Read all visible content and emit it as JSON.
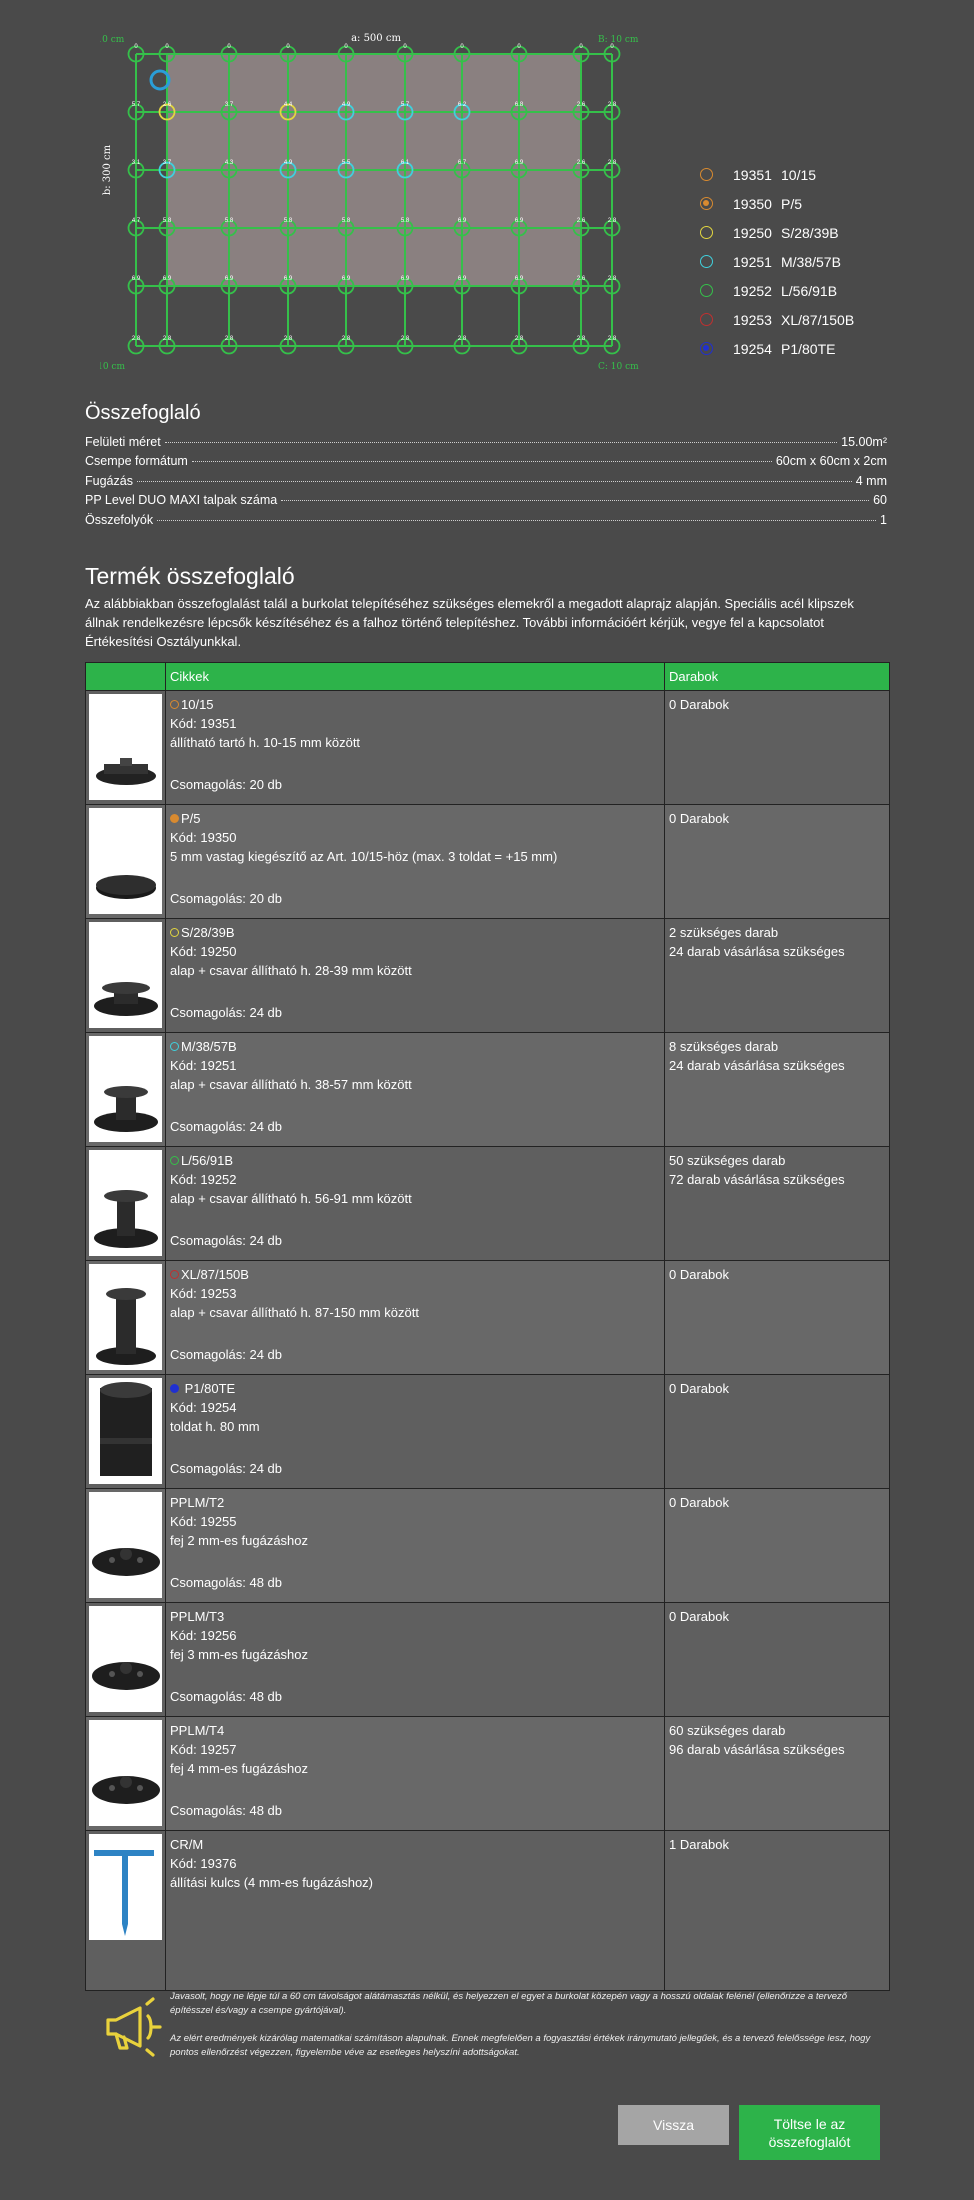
{
  "plan": {
    "width_label": "a: 500 cm",
    "height_label": "b: 300 cm",
    "corner_a": "A: 10 cm",
    "corner_b": "B: 10 cm",
    "corner_c": "C: 10 cm",
    "corner_d": "D: 10 cm",
    "row_labels": [
      [
        "0",
        "0",
        "0",
        "0",
        "0",
        "0",
        "0",
        "0",
        "0",
        "0"
      ],
      [
        "5.7",
        "2.6",
        "3.7",
        "4.4",
        "4.9",
        "5.7",
        "6.2",
        "6.8",
        "2.6",
        "2.8"
      ],
      [
        "3.1",
        "3.7",
        "4.3",
        "4.9",
        "5.5",
        "6.1",
        "6.7",
        "6.9",
        "2.6",
        "2.8"
      ],
      [
        "4.7",
        "5.8",
        "5.8",
        "5.8",
        "5.8",
        "5.8",
        "6.9",
        "6.9",
        "2.6",
        "2.8"
      ],
      [
        "6.9",
        "6.9",
        "6.9",
        "6.9",
        "6.9",
        "6.9",
        "6.9",
        "6.9",
        "2.6",
        "2.8"
      ],
      [
        "2.8",
        "2.8",
        "2.8",
        "2.8",
        "2.8",
        "2.8",
        "2.8",
        "2.8",
        "2.8",
        "2.8"
      ]
    ],
    "row_colors": [
      [
        "green",
        "green",
        "green",
        "green",
        "green",
        "green",
        "green",
        "green",
        "green",
        "green"
      ],
      [
        "green",
        "yellow",
        "green",
        "yellow",
        "cyan",
        "cyan",
        "cyan",
        "green",
        "green",
        "green"
      ],
      [
        "green",
        "cyan",
        "green",
        "cyan",
        "cyan",
        "cyan",
        "green",
        "green",
        "green",
        "green"
      ],
      [
        "green",
        "green",
        "green",
        "green",
        "green",
        "green",
        "green",
        "green",
        "green",
        "green"
      ],
      [
        "green",
        "green",
        "green",
        "green",
        "green",
        "green",
        "green",
        "green",
        "green",
        "green"
      ],
      [
        "green",
        "green",
        "green",
        "green",
        "green",
        "green",
        "green",
        "green",
        "green",
        "green"
      ]
    ],
    "colors": {
      "green": "#35c04a",
      "yellow": "#e2d640",
      "cyan": "#40d0dc",
      "blue": "#2a9ed8",
      "tile": "#8a8080"
    }
  },
  "legend": [
    {
      "code": "19351",
      "name": "10/15",
      "color": "#d88a30",
      "fill": ""
    },
    {
      "code": "19350",
      "name": "P/5",
      "color": "#d88a30",
      "fill": "#d88a30"
    },
    {
      "code": "19250",
      "name": "S/28/39B",
      "color": "#e2d640",
      "fill": ""
    },
    {
      "code": "19251",
      "name": "M/38/57B",
      "color": "#40d0dc",
      "fill": ""
    },
    {
      "code": "19252",
      "name": "L/56/91B",
      "color": "#35c04a",
      "fill": ""
    },
    {
      "code": "19253",
      "name": "XL/87/150B",
      "color": "#c03030",
      "fill": ""
    },
    {
      "code": "19254",
      "name": "P1/80TE",
      "color": "#2030d0",
      "fill": "#2030d0"
    }
  ],
  "summary": {
    "title": "Összefoglaló",
    "rows": [
      {
        "label": "Felületi méret",
        "value": "15.00m²"
      },
      {
        "label": "Csempe formátum",
        "value": "60cm x 60cm x 2cm"
      },
      {
        "label": "Fugázás",
        "value": "4 mm"
      },
      {
        "label": "PP Level DUO MAXI talpak száma",
        "value": "60"
      },
      {
        "label": "Összefolyók",
        "value": "1"
      }
    ]
  },
  "products": {
    "title": "Termék összefoglaló",
    "description": "Az alábbiakban összefoglalást talál a burkolat telepítéséhez szükséges elemekről a megadott alaprajz alapján. Speciális acél klipszek állnak rendelkezésre lépcsők készítéséhez és a falhoz történő telepítéshez. További információért kérjük, vegye fel a kapcsolatot Értékesítési Osztályunkkal.",
    "col_items": "Cikkek",
    "col_pieces": "Darabok",
    "items": [
      {
        "name": "10/15",
        "code": "Kód: 19351",
        "desc": "állítható tartó h. 10-15 mm között",
        "pack": "Csomagolás: 20 db",
        "qty1": "0 Darabok",
        "qty2": "",
        "dot": "#d88a30",
        "dotfill": ""
      },
      {
        "name": "P/5",
        "code": "Kód: 19350",
        "desc": "5 mm vastag kiegészítő az Art. 10/15-höz (max. 3 toldat = +15 mm)",
        "pack": "Csomagolás: 20 db",
        "qty1": "0 Darabok",
        "qty2": "",
        "dot": "#d88a30",
        "dotfill": "#d88a30"
      },
      {
        "name": "S/28/39B",
        "code": "Kód: 19250",
        "desc": "alap + csavar állítható h. 28-39 mm között",
        "pack": "Csomagolás: 24 db",
        "qty1": "2 szükséges darab",
        "qty2": "24 darab vásárlása szükséges",
        "dot": "#e2d640",
        "dotfill": ""
      },
      {
        "name": "M/38/57B",
        "code": "Kód: 19251",
        "desc": "alap + csavar állítható h. 38-57 mm között",
        "pack": "Csomagolás: 24 db",
        "qty1": "8 szükséges darab",
        "qty2": "24 darab vásárlása szükséges",
        "dot": "#40d0dc",
        "dotfill": ""
      },
      {
        "name": "L/56/91B",
        "code": "Kód: 19252",
        "desc": "alap + csavar állítható h. 56-91 mm között",
        "pack": "Csomagolás: 24 db",
        "qty1": "50 szükséges darab",
        "qty2": "72 darab vásárlása szükséges",
        "dot": "#35c04a",
        "dotfill": ""
      },
      {
        "name": "XL/87/150B",
        "code": "Kód: 19253",
        "desc": "alap + csavar állítható h. 87-150 mm között",
        "pack": "Csomagolás: 24 db",
        "qty1": "0 Darabok",
        "qty2": "",
        "dot": "#c03030",
        "dotfill": ""
      },
      {
        "name": " P1/80TE",
        "code": "Kód: 19254",
        "desc": "toldat h. 80 mm",
        "pack": "Csomagolás: 24 db",
        "qty1": "0 Darabok",
        "qty2": "",
        "dot": "#2030d0",
        "dotfill": "#2030d0"
      },
      {
        "name": "PPLM/T2",
        "code": "Kód: 19255",
        "desc": "fej 2 mm-es fugázáshoz",
        "pack": "Csomagolás: 48 db",
        "qty1": "0 Darabok",
        "qty2": "",
        "dot": "",
        "dotfill": ""
      },
      {
        "name": "PPLM/T3",
        "code": "Kód: 19256",
        "desc": "fej 3 mm-es fugázáshoz",
        "pack": "Csomagolás: 48 db",
        "qty1": "0 Darabok",
        "qty2": "",
        "dot": "",
        "dotfill": ""
      },
      {
        "name": "PPLM/T4",
        "code": "Kód: 19257",
        "desc": "fej 4 mm-es fugázáshoz",
        "pack": "Csomagolás: 48 db",
        "qty1": "60 szükséges darab",
        "qty2": "96 darab vásárlása szükséges",
        "dot": "",
        "dotfill": ""
      },
      {
        "name": "CR/M",
        "code": "Kód: 19376",
        "desc": "állítási kulcs (4 mm-es fugázáshoz)",
        "pack": "",
        "qty1": "1 Darabok",
        "qty2": "",
        "dot": "",
        "dotfill": ""
      }
    ]
  },
  "notes": {
    "note1": "Javasolt, hogy ne lépje túl a 60 cm távolságot alátámasztás nélkül, és helyezzen el egyet a burkolat közepén vagy a hosszú oldalak felénél (ellenőrizze a tervező építésszel és/vagy a csempe gyártójával).",
    "note2": "Az elért eredmények kizárólag matematikai számításon alapulnak. Ennek megfelelően a fogyasztási értékek iránymutató jellegűek, és a tervező felelőssége lesz, hogy pontos ellenőrzést végezzen, figyelembe véve az esetleges helyszíni adottságokat."
  },
  "buttons": {
    "back": "Vissza",
    "fill": "Töltse le az összefoglalót"
  }
}
